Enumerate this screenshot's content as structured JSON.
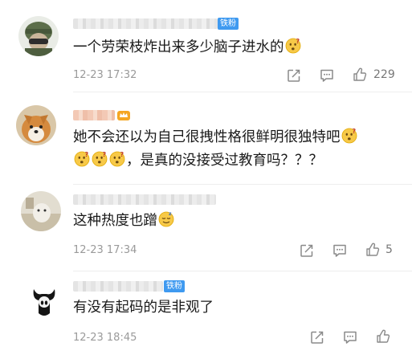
{
  "badge_label": "铁粉",
  "comments": [
    {
      "text": "一个劳荣枝炸出来多少脑子进水的",
      "time": "12-23 17:32",
      "likes": "229",
      "has_badge": true
    },
    {
      "text_line1": "她不会还以为自己很拽性格很鲜明很独特吧",
      "text_line2": "，是真的没接受过教育吗？？？",
      "crown_icon": "vip-crown-icon"
    },
    {
      "text": "这种热度也蹭",
      "time": "12-23 17:34",
      "likes": "5"
    },
    {
      "text": "有没有起码的是非观了",
      "time": "12-23 18:45",
      "has_badge": true
    }
  ],
  "colors": {
    "badge": "#3f9af0",
    "time": "#9a9a9a",
    "icon": "#8a8a8a"
  }
}
